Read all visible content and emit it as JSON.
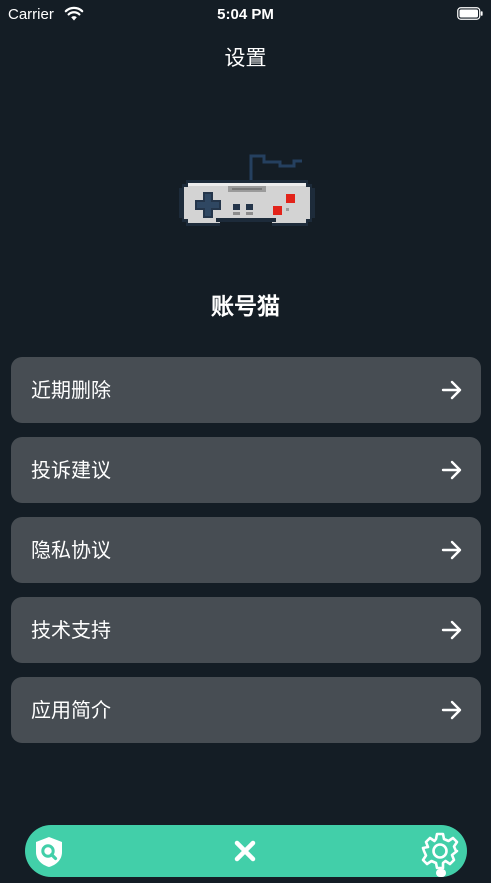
{
  "status_bar": {
    "carrier": "Carrier",
    "time": "5:04 PM"
  },
  "nav": {
    "title": "设置"
  },
  "app": {
    "name": "账号猫"
  },
  "menu": {
    "items": [
      {
        "label": "近期删除"
      },
      {
        "label": "投诉建议"
      },
      {
        "label": "隐私协议"
      },
      {
        "label": "技术支持"
      },
      {
        "label": "应用简介"
      }
    ]
  },
  "tab_bar": {
    "tabs": [
      {
        "icon": "shield-search-icon"
      },
      {
        "icon": "close-icon"
      },
      {
        "icon": "gear-icon",
        "active": true
      }
    ]
  },
  "colors": {
    "background": "#141d25",
    "card": "#474d53",
    "accent": "#42cfa9",
    "text": "#ffffff"
  }
}
